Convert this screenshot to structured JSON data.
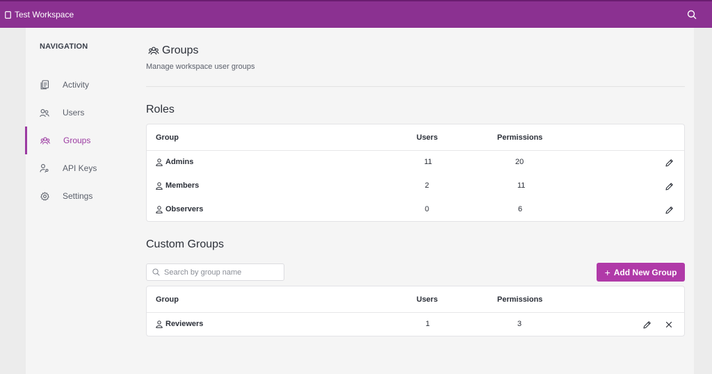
{
  "workspace": {
    "name": "Test Workspace"
  },
  "nav": {
    "title": "NAVIGATION",
    "items": [
      {
        "label": "Activity",
        "icon": "clipboard-icon"
      },
      {
        "label": "Users",
        "icon": "users-icon"
      },
      {
        "label": "Groups",
        "icon": "groups-icon",
        "active": true
      },
      {
        "label": "API Keys",
        "icon": "api-key-icon"
      },
      {
        "label": "Settings",
        "icon": "gear-icon"
      }
    ]
  },
  "page": {
    "title": "Groups",
    "subtitle": "Manage workspace user groups"
  },
  "roles": {
    "title": "Roles",
    "headers": {
      "group": "Group",
      "users": "Users",
      "permissions": "Permissions"
    },
    "rows": [
      {
        "name": "Admins",
        "users": "11",
        "permissions": "20"
      },
      {
        "name": "Members",
        "users": "2",
        "permissions": "11"
      },
      {
        "name": "Observers",
        "users": "0",
        "permissions": "6"
      }
    ]
  },
  "custom_groups": {
    "title": "Custom Groups",
    "search_placeholder": "Search by group name",
    "add_label": "Add New Group",
    "headers": {
      "group": "Group",
      "users": "Users",
      "permissions": "Permissions"
    },
    "rows": [
      {
        "name": "Reviewers",
        "users": "1",
        "permissions": "3"
      }
    ]
  },
  "colors": {
    "topbar": "#8b3191",
    "accent": "#b03aa8",
    "active_nav": "#9b3aa1"
  }
}
